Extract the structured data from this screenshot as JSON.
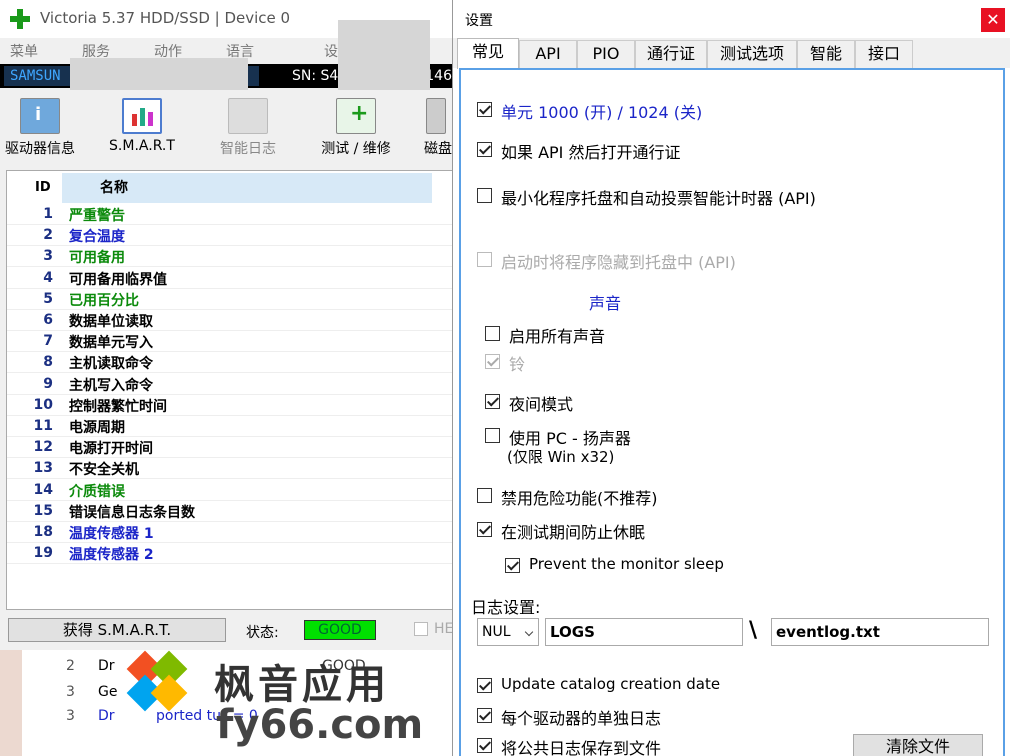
{
  "main": {
    "title": "Victoria 5.37 HDD/SSD | Device 0",
    "menu": [
      "菜单",
      "服务",
      "动作",
      "语言",
      "设"
    ],
    "drive_model": "SAMSUN",
    "drive_sn_label": "SN: S4",
    "drive_sn_tail": "146",
    "toolbar": [
      {
        "label": "驱动器信息",
        "icon": "info-icon"
      },
      {
        "label": "S.M.A.R.T",
        "icon": "smart-chart-icon"
      },
      {
        "label": "智能日志",
        "icon": "smart-log-icon"
      },
      {
        "label": "测试 / 维修",
        "icon": "test-repair-icon"
      },
      {
        "label": "磁盘",
        "icon": "disk-icon"
      }
    ],
    "table_header": {
      "id": "ID",
      "name": "名称"
    },
    "attributes": [
      {
        "id": "1",
        "name": "严重警告",
        "color": "#0b8a0b"
      },
      {
        "id": "2",
        "name": "复合温度",
        "color": "#1b25c8"
      },
      {
        "id": "3",
        "name": "可用备用",
        "color": "#0b8a0b"
      },
      {
        "id": "4",
        "name": "可用备用临界值",
        "color": "#000000"
      },
      {
        "id": "5",
        "name": "已用百分比",
        "color": "#0b8a0b"
      },
      {
        "id": "6",
        "name": "数据单位读取",
        "color": "#000000"
      },
      {
        "id": "7",
        "name": "数据单元写入",
        "color": "#000000"
      },
      {
        "id": "8",
        "name": "主机读取命令",
        "color": "#000000"
      },
      {
        "id": "9",
        "name": "主机写入命令",
        "color": "#000000"
      },
      {
        "id": "10",
        "name": "控制器繁忙时间",
        "color": "#000000"
      },
      {
        "id": "11",
        "name": "电源周期",
        "color": "#000000"
      },
      {
        "id": "12",
        "name": "电源打开时间",
        "color": "#000000"
      },
      {
        "id": "13",
        "name": "不安全关机",
        "color": "#000000"
      },
      {
        "id": "14",
        "name": "介质错误",
        "color": "#0b8a0b"
      },
      {
        "id": "15",
        "name": "错误信息日志条目数",
        "color": "#000000"
      },
      {
        "id": "18",
        "name": "温度传感器 1",
        "color": "#1b25c8"
      },
      {
        "id": "19",
        "name": "温度传感器 2",
        "color": "#1b25c8"
      }
    ],
    "get_smart_label": "获得 S.M.A.R.T.",
    "status_label": "状态:",
    "status_value": "GOOD",
    "he_label": "HE",
    "log_rows": [
      {
        "n": "2",
        "t": "Dr",
        "extra": "GOOD"
      },
      {
        "n": "3",
        "t": "Ge",
        "extra": ""
      },
      {
        "n": "3",
        "t": "Dr",
        "extra": "ported       tus = 0"
      }
    ],
    "watermark_text": "枫音应用",
    "watermark_url": "fy66.com"
  },
  "dialog": {
    "title": "设置",
    "close_label": "✕",
    "tabs": [
      "常见",
      "API",
      "PIO",
      "通行证",
      "测试选项",
      "智能",
      "接口"
    ],
    "active_tab": 0,
    "options": {
      "unit": {
        "label": "单元 1000 (开) / 1024 (关)",
        "checked": true
      },
      "api_passport": {
        "label": "如果 API 然后打开通行证",
        "checked": true
      },
      "minimize_tray": {
        "label": "最小化程序托盘和自动投票智能计时器 (API)",
        "checked": false
      },
      "hide_startup": {
        "label": "启动时将程序隐藏到托盘中 (API)",
        "checked": false
      },
      "sound_header": "声音",
      "all_sounds": {
        "label": "启用所有声音",
        "checked": false
      },
      "bell": {
        "label": "铃",
        "checked": true
      },
      "night_mode": {
        "label": "夜间模式",
        "checked": true
      },
      "pc_speaker": {
        "label": "使用 PC - 扬声器",
        "checked": false
      },
      "pc_speaker_note": "(仅限 Win x32)",
      "disable_danger": {
        "label": "禁用危险功能(不推荐)",
        "checked": false
      },
      "prevent_sleep": {
        "label": "在测试期间防止休眠",
        "checked": true
      },
      "prevent_monitor": {
        "label": "Prevent the monitor sleep",
        "checked": true
      },
      "log_settings": "日志设置:",
      "log_select": "NUL",
      "log_dir": "LOGS",
      "log_sep": "\\",
      "log_file": "eventlog.txt",
      "update_catalog": {
        "label": "Update catalog creation date",
        "checked": true
      },
      "per_drive_log": {
        "label": "每个驱动器的单独日志",
        "checked": true
      },
      "save_public_log": {
        "label": "将公共日志保存到文件",
        "checked": true
      },
      "clear_button": "清除文件"
    }
  }
}
